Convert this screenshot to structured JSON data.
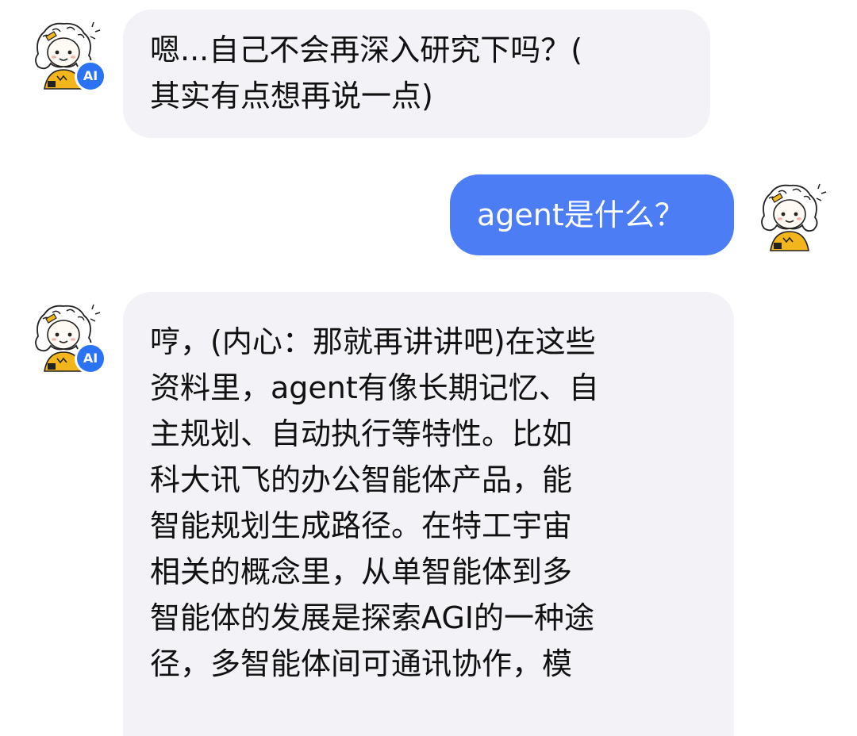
{
  "messages": [
    {
      "sender": "ai",
      "badge": "AI",
      "lines": [
        "嗯...自己不会再深入研究下吗？(",
        "其实有点想再说一点)"
      ]
    },
    {
      "sender": "user",
      "lines": [
        "agent是什么？"
      ]
    },
    {
      "sender": "ai",
      "badge": "AI",
      "lines": [
        "哼，(内心：那就再讲讲吧)在这些",
        "资料里，agent有像长期记忆、自",
        "主规划、自动执行等特性。比如",
        "科大讯飞的办公智能体产品，能",
        "智能规划生成路径。在特工宇宙",
        "相关的概念里，从单智能体到多",
        "智能体的发展是探索AGI的一种途",
        "径，多智能体间可通讯协作，模"
      ]
    }
  ],
  "colors": {
    "ai_bubble": "#f2f2f7",
    "user_bubble": "#4c7df5",
    "ai_badge": "#2b73f5",
    "avatar_accent": "#f3b51c"
  },
  "icons": {
    "ai_avatar": "cartoon-girl-avatar",
    "user_avatar": "cartoon-girl-avatar"
  }
}
